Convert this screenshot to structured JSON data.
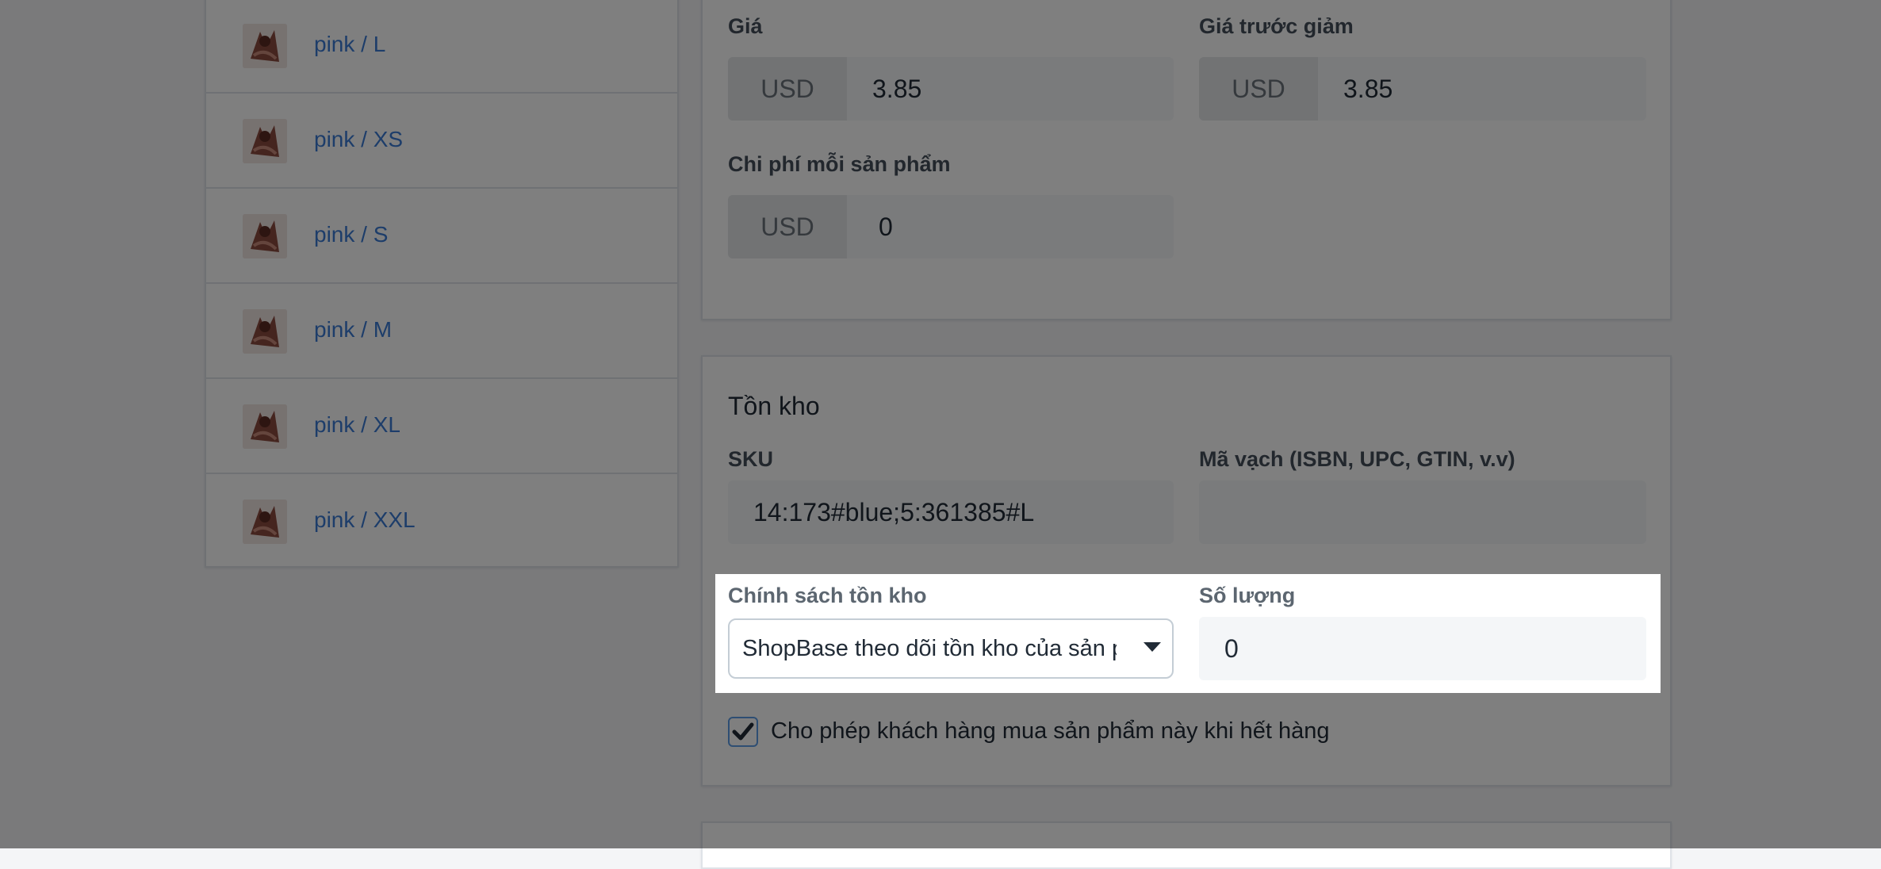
{
  "variants": [
    {
      "label": "pink / L"
    },
    {
      "label": "pink / XS"
    },
    {
      "label": "pink / S"
    },
    {
      "label": "pink / M"
    },
    {
      "label": "pink / XL"
    },
    {
      "label": "pink / XXL"
    }
  ],
  "pricing": {
    "price_label": "Giá",
    "price_currency": "USD",
    "price_value": "3.85",
    "compare_label": "Giá trước giảm",
    "compare_currency": "USD",
    "compare_value": "3.85",
    "cost_label": "Chi phí mỗi sản phẩm",
    "cost_currency": "USD",
    "cost_value": "0"
  },
  "inventory": {
    "title": "Tồn kho",
    "sku_label": "SKU",
    "sku_value": "14:173#blue;5:361385#L",
    "barcode_label": "Mã vạch (ISBN, UPC, GTIN, v.v)",
    "barcode_value": "",
    "policy_label": "Chính sách tồn kho",
    "policy_selected": "ShopBase theo dõi tồn kho của sản phẩm",
    "quantity_label": "Số lượng",
    "quantity_value": "0",
    "allow_oos_label": "Cho phép khách hàng mua sản phẩm này khi hết hàng",
    "allow_oos_checked": true
  },
  "icons": {
    "caret": "chevron-down-icon",
    "check": "checkmark-icon"
  }
}
